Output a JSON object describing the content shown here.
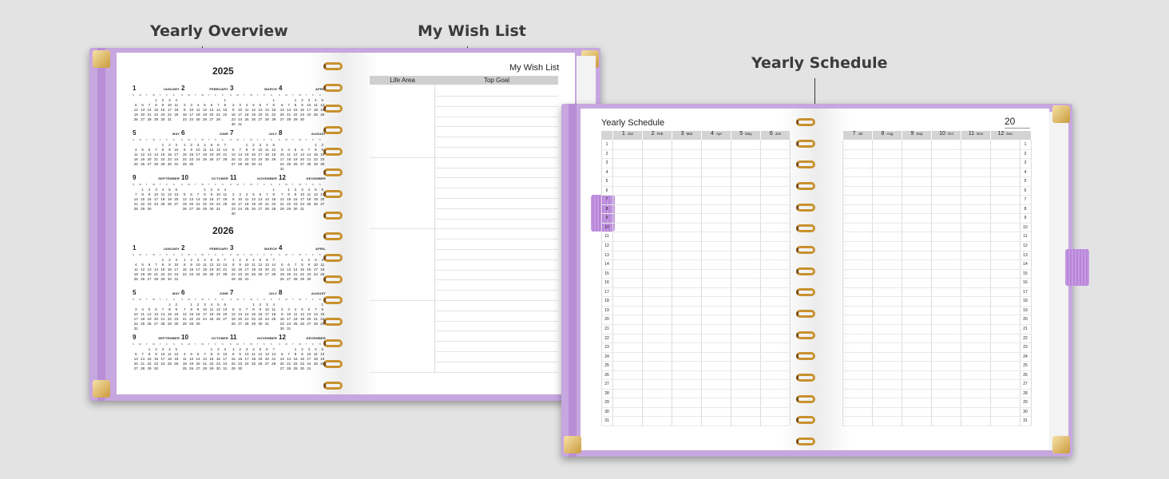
{
  "callouts": {
    "overview": "Yearly Overview",
    "wishlist": "My Wish List",
    "schedule": "Yearly Schedule"
  },
  "overview": {
    "years": [
      {
        "year": "2025",
        "months": [
          {
            "num": "1",
            "name": "JANUARY",
            "offset": 3,
            "days": 31
          },
          {
            "num": "2",
            "name": "FEBRUARY",
            "offset": 6,
            "days": 28
          },
          {
            "num": "3",
            "name": "MARCH",
            "offset": 6,
            "days": 31
          },
          {
            "num": "4",
            "name": "APRIL",
            "offset": 2,
            "days": 30
          },
          {
            "num": "5",
            "name": "MAY",
            "offset": 4,
            "days": 31
          },
          {
            "num": "6",
            "name": "JUNE",
            "offset": 0,
            "days": 30
          },
          {
            "num": "7",
            "name": "JULY",
            "offset": 2,
            "days": 31
          },
          {
            "num": "8",
            "name": "AUGUST",
            "offset": 5,
            "days": 31
          },
          {
            "num": "9",
            "name": "SEPTEMBER",
            "offset": 1,
            "days": 30
          },
          {
            "num": "10",
            "name": "OCTOBER",
            "offset": 3,
            "days": 31
          },
          {
            "num": "11",
            "name": "NOVEMBER",
            "offset": 6,
            "days": 30
          },
          {
            "num": "12",
            "name": "DECEMBER",
            "offset": 1,
            "days": 31
          }
        ]
      },
      {
        "year": "2026",
        "months": [
          {
            "num": "1",
            "name": "JANUARY",
            "offset": 4,
            "days": 31
          },
          {
            "num": "2",
            "name": "FEBRUARY",
            "offset": 0,
            "days": 28
          },
          {
            "num": "3",
            "name": "MARCH",
            "offset": 0,
            "days": 31
          },
          {
            "num": "4",
            "name": "APRIL",
            "offset": 3,
            "days": 30
          },
          {
            "num": "5",
            "name": "MAY",
            "offset": 5,
            "days": 31
          },
          {
            "num": "6",
            "name": "JUNE",
            "offset": 1,
            "days": 30
          },
          {
            "num": "7",
            "name": "JULY",
            "offset": 3,
            "days": 31
          },
          {
            "num": "8",
            "name": "AUGUST",
            "offset": 6,
            "days": 31
          },
          {
            "num": "9",
            "name": "SEPTEMBER",
            "offset": 2,
            "days": 30
          },
          {
            "num": "10",
            "name": "OCTOBER",
            "offset": 4,
            "days": 31
          },
          {
            "num": "11",
            "name": "NOVEMBER",
            "offset": 0,
            "days": 30
          },
          {
            "num": "12",
            "name": "DECEMBER",
            "offset": 2,
            "days": 31
          }
        ]
      }
    ],
    "weekdays": [
      "S",
      "M",
      "T",
      "W",
      "T",
      "F",
      "S"
    ]
  },
  "wishlist": {
    "title": "My Wish List",
    "col_area": "Life Area",
    "col_goal": "Top Goal"
  },
  "schedule": {
    "title": "Yearly Schedule",
    "year_prefix": "20",
    "left_months": [
      {
        "n": "1",
        "a": "Jan"
      },
      {
        "n": "2",
        "a": "Feb"
      },
      {
        "n": "3",
        "a": "Mar"
      },
      {
        "n": "4",
        "a": "Apr"
      },
      {
        "n": "5",
        "a": "May"
      },
      {
        "n": "6",
        "a": "Jun"
      }
    ],
    "right_months": [
      {
        "n": "7",
        "a": "Jul"
      },
      {
        "n": "8",
        "a": "Aug"
      },
      {
        "n": "9",
        "a": "Sep"
      },
      {
        "n": "10",
        "a": "Oct"
      },
      {
        "n": "11",
        "a": "Nov"
      },
      {
        "n": "12",
        "a": "Dec"
      }
    ],
    "day_count": 31
  },
  "colors": {
    "cover": "#c7a7df",
    "spiral": "#c8912e",
    "header_gray": "#cfcfcf",
    "background": "#e3e3e3"
  }
}
